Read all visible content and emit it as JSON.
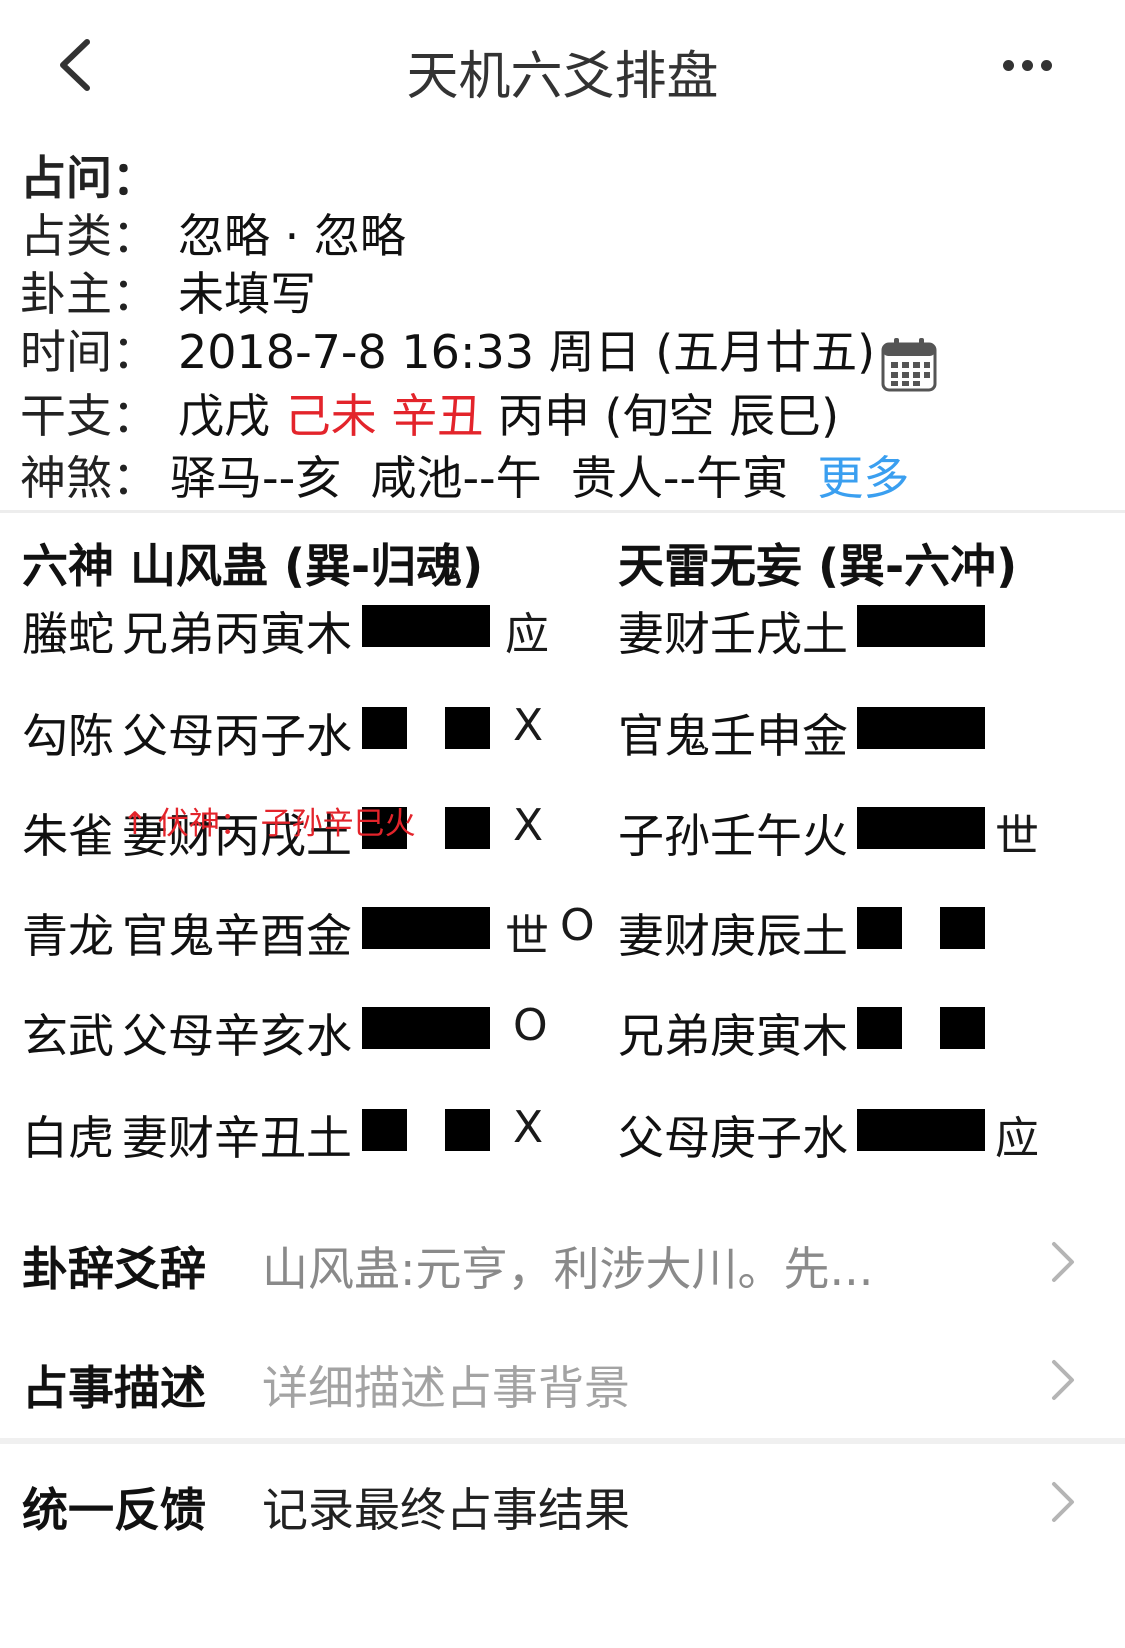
{
  "header": {
    "title": "天机六爻排盘"
  },
  "info": {
    "question_label": "占问：",
    "category_label": "占类：",
    "category_value": "忽略 · 忽略",
    "owner_label": "卦主：",
    "owner_value": "未填写",
    "time_label": "时间：",
    "time_value": "2018-7-8 16:33 周日 (五月廿五)",
    "ganzhi_label": "干支：",
    "ganzhi_year": "戊戌",
    "ganzhi_month": "己未",
    "ganzhi_day": "辛丑",
    "ganzhi_hour": "丙申",
    "ganzhi_void": "(旬空 辰巳)",
    "shensha_label": "神煞：",
    "shensha_items": [
      "驿马--亥",
      "咸池--午",
      "贵人--午寅"
    ],
    "shensha_more": "更多"
  },
  "hexagram": {
    "left_header": "六神  山风蛊 (巽-归魂)",
    "right_header": "天雷无妄 (巽-六冲)",
    "left_rows": [
      {
        "spirit": "螣蛇",
        "line": "兄弟丙寅木",
        "yao": "yang",
        "mark": "应",
        "move": ""
      },
      {
        "spirit": "勾陈",
        "line": "父母丙子水",
        "yao": "yin",
        "mark": "",
        "move": "X"
      },
      {
        "spirit": "朱雀",
        "line": "妻财丙戌土",
        "yao": "yin",
        "mark": "",
        "move": "X"
      },
      {
        "spirit": "青龙",
        "line": "官鬼辛酉金",
        "yao": "yang",
        "mark": "世",
        "move": "O"
      },
      {
        "spirit": "玄武",
        "line": "父母辛亥水",
        "yao": "yang",
        "mark": "",
        "move": "O"
      },
      {
        "spirit": "白虎",
        "line": "妻财辛丑土",
        "yao": "yin",
        "mark": "",
        "move": "X"
      }
    ],
    "fushen": "↑ 伏神：  子孙辛巳火",
    "right_rows": [
      {
        "line": "妻财壬戌土",
        "yao": "yang",
        "mark": ""
      },
      {
        "line": "官鬼壬申金",
        "yao": "yang",
        "mark": ""
      },
      {
        "line": "子孙壬午火",
        "yao": "yang",
        "mark": "世"
      },
      {
        "line": "妻财庚辰土",
        "yao": "yin",
        "mark": ""
      },
      {
        "line": "兄弟庚寅木",
        "yao": "yin",
        "mark": ""
      },
      {
        "line": "父母庚子水",
        "yao": "yang",
        "mark": "应"
      }
    ]
  },
  "sections": {
    "guaci_label": "卦辞爻辞",
    "guaci_value": "山风蛊:元亨，利涉大川。先...",
    "desc_label": "占事描述",
    "desc_placeholder": "详细描述占事背景",
    "feedback_label": "统一反馈",
    "feedback_value": "记录最终占事结果"
  }
}
